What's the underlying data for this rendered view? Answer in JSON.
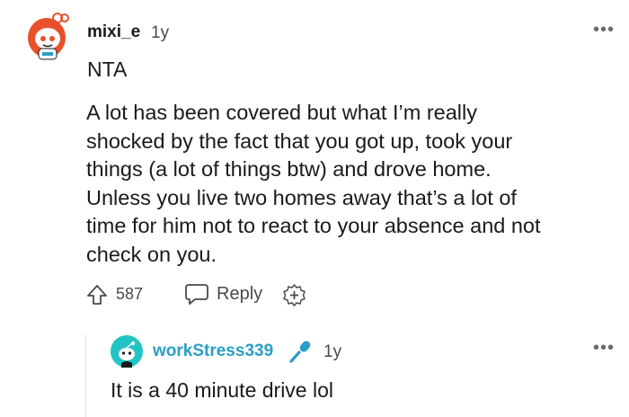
{
  "comment": {
    "username": "mixi_e",
    "age": "1y",
    "more": "•••",
    "verdict": "NTA",
    "body": "A lot has been covered but what I’m really\nshocked by the fact that you got up, took your\nthings (a lot of things btw) and drove home.\nUnless you live two homes away that’s a lot of\ntime for him not to react to your absence and not\ncheck on you.",
    "score": "587",
    "reply_label": "Reply",
    "avatar_icon": "snoo-avatar-icon",
    "upvote_icon": "upvote-arrow-icon",
    "reply_icon": "speech-bubble-icon",
    "award_icon": "add-award-icon"
  },
  "reply": {
    "username": "workStress339",
    "age": "1y",
    "more": "•••",
    "body": "It is a 40 minute drive lol",
    "avatar_icon": "snoo-avatar-icon",
    "flair_icon": "microphone-icon"
  },
  "colors": {
    "accent_username": "#2a9ec8",
    "text": "#1a1a1b",
    "meta": "#4a4a4a",
    "avatar_red": "#e8502c",
    "avatar_teal": "#23c4c4"
  }
}
